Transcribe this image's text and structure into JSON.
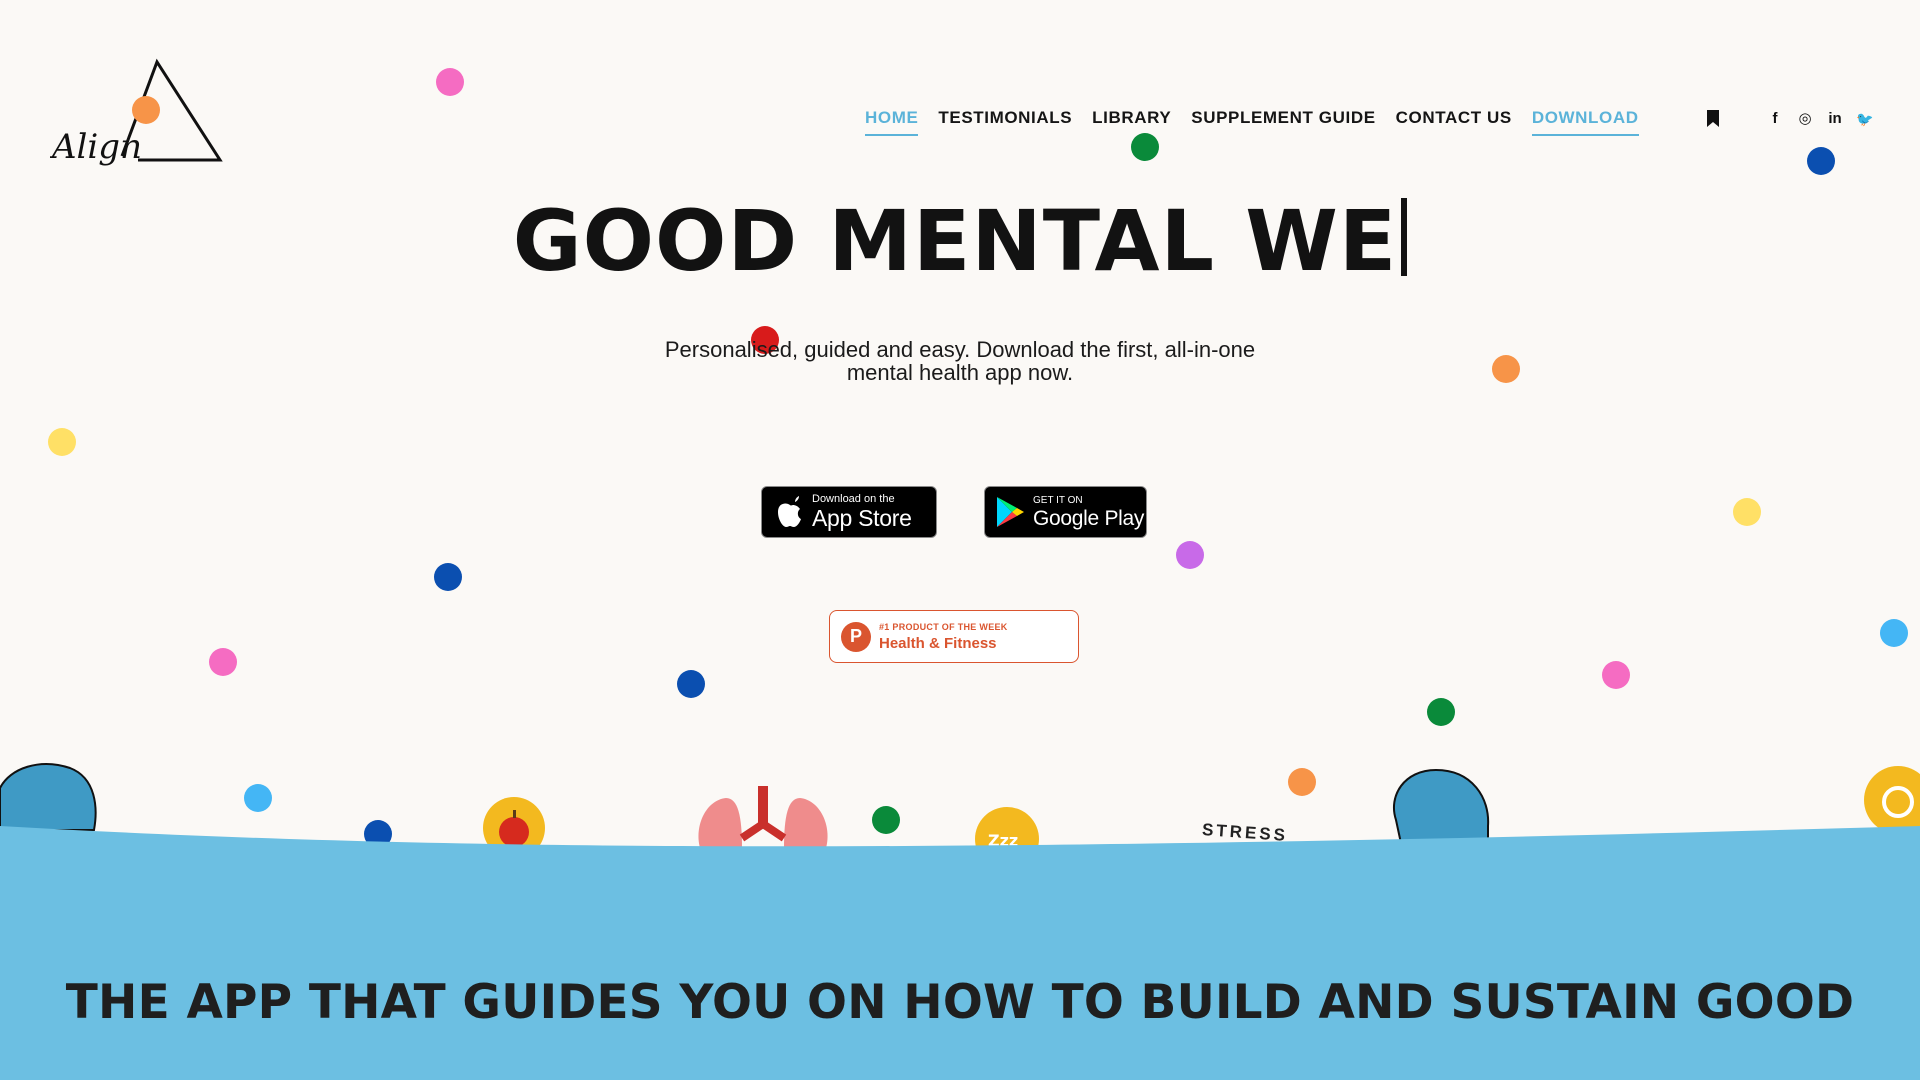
{
  "brand": {
    "logo_text": "Align",
    "logo_icon": "triangle-logo-icon"
  },
  "nav": {
    "items": [
      {
        "label": "HOME",
        "active": true
      },
      {
        "label": "TESTIMONIALS",
        "active": false
      },
      {
        "label": "LIBRARY",
        "active": false
      },
      {
        "label": "SUPPLEMENT GUIDE",
        "active": false
      },
      {
        "label": "CONTACT US",
        "active": false
      },
      {
        "label": "DOWNLOAD",
        "active": true
      }
    ],
    "accent_color": "#5bb3d9"
  },
  "social": {
    "icons": [
      "bookmark-icon",
      "facebook-icon",
      "instagram-icon",
      "linkedin-icon",
      "twitter-icon"
    ],
    "glyphs": {
      "facebook": "f",
      "instagram": "◎",
      "linkedin": "in",
      "twitter": "🐦"
    }
  },
  "hero": {
    "title": "GOOD MENTAL WE",
    "subtitle": "Personalised, guided and easy. Download the first, all-in-one mental health app now."
  },
  "stores": {
    "apple_small": "Download on the",
    "apple_big": "App Store",
    "google_small": "GET IT ON",
    "google_big": "Google Play"
  },
  "product_hunt": {
    "letter": "P",
    "line1": "#1 PRODUCT OF THE WEEK",
    "line2": "Health & Fitness",
    "color": "#da552f"
  },
  "illustrations": {
    "stress_label": "STRESS",
    "icons": [
      "head-silhouette-icon",
      "apple-icon",
      "lungs-icon",
      "sleep-icon",
      "head-silhouette-icon",
      "gauge-icon"
    ]
  },
  "section": {
    "title": "THE APP THAT GUIDES YOU ON HOW TO BUILD AND SUSTAIN GOOD",
    "background": "#6cbfe2"
  },
  "dot_colors": [
    "#f56cc2",
    "#f79448",
    "#0a8a3a",
    "#0b4fb0",
    "#ffe066",
    "#44b6f5",
    "#c86ae8",
    "#d81b1b"
  ]
}
